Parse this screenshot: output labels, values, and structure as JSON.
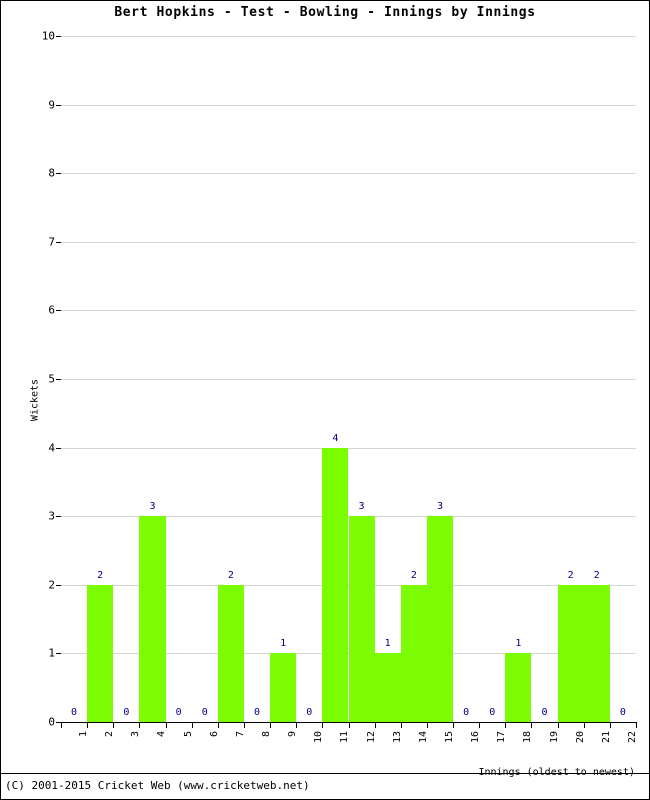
{
  "chart_data": {
    "type": "bar",
    "title": "Bert Hopkins - Test - Bowling - Innings by Innings",
    "xlabel": "Innings (oldest to newest)",
    "ylabel": "Wickets",
    "categories": [
      "1",
      "2",
      "3",
      "4",
      "5",
      "6",
      "7",
      "8",
      "9",
      "10",
      "11",
      "12",
      "13",
      "14",
      "15",
      "16",
      "17",
      "18",
      "19",
      "20",
      "21",
      "22"
    ],
    "values": [
      0,
      2,
      0,
      3,
      0,
      0,
      2,
      0,
      1,
      0,
      4,
      3,
      1,
      2,
      3,
      0,
      0,
      1,
      0,
      2,
      2,
      0
    ],
    "data_labels": [
      "0",
      "2",
      "0",
      "3",
      "0",
      "0",
      "2",
      "0",
      "1",
      "0",
      "4",
      "3",
      "1",
      "2",
      "3",
      "0",
      "0",
      "1",
      "0",
      "2",
      "2",
      "0"
    ],
    "ylim": [
      0,
      10
    ],
    "ytick_values": [
      0,
      1,
      2,
      3,
      4,
      5,
      6,
      7,
      8,
      9,
      10
    ],
    "ytick_labels": [
      "0",
      "1",
      "2",
      "3",
      "4",
      "5",
      "6",
      "7",
      "8",
      "9",
      "10"
    ],
    "grid": true,
    "legend": false,
    "bar_color": "#7CFC00",
    "label_color": "#00007f",
    "grid_color": "#d4d4d4",
    "axis_color": "#000000"
  },
  "footer": {
    "copyright": "(C) 2001-2015 Cricket Web (www.cricketweb.net)"
  }
}
